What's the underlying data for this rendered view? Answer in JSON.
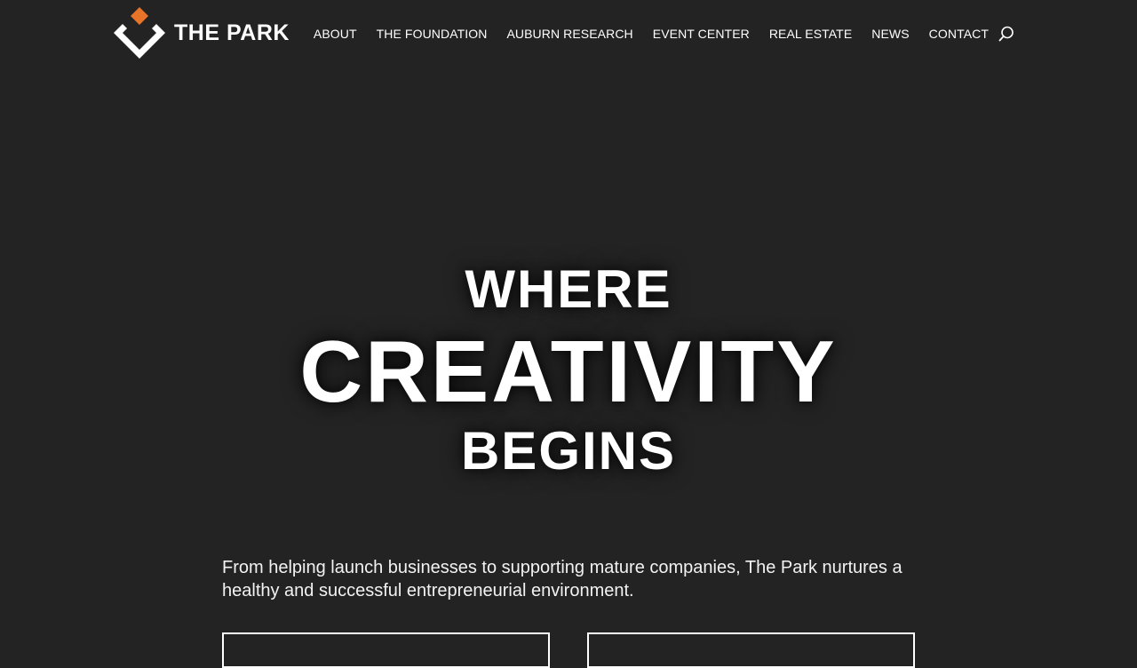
{
  "header": {
    "logo_text": "THE PARK",
    "brand_accent": "#e8742a",
    "nav": [
      {
        "label": "ABOUT"
      },
      {
        "label": "THE FOUNDATION"
      },
      {
        "label": "AUBURN RESEARCH"
      },
      {
        "label": "EVENT CENTER"
      },
      {
        "label": "REAL ESTATE"
      },
      {
        "label": "NEWS"
      },
      {
        "label": "CONTACT"
      }
    ],
    "search_icon": "search-icon"
  },
  "hero": {
    "line1": "WHERE",
    "line2": "CREATIVITY",
    "line3": "BEGINS"
  },
  "intro": {
    "text": "From helping launch businesses to supporting mature companies, The Park nurtures a healthy and successful entrepreneurial environment."
  },
  "colors": {
    "background": "#232323",
    "text": "#ffffff"
  }
}
